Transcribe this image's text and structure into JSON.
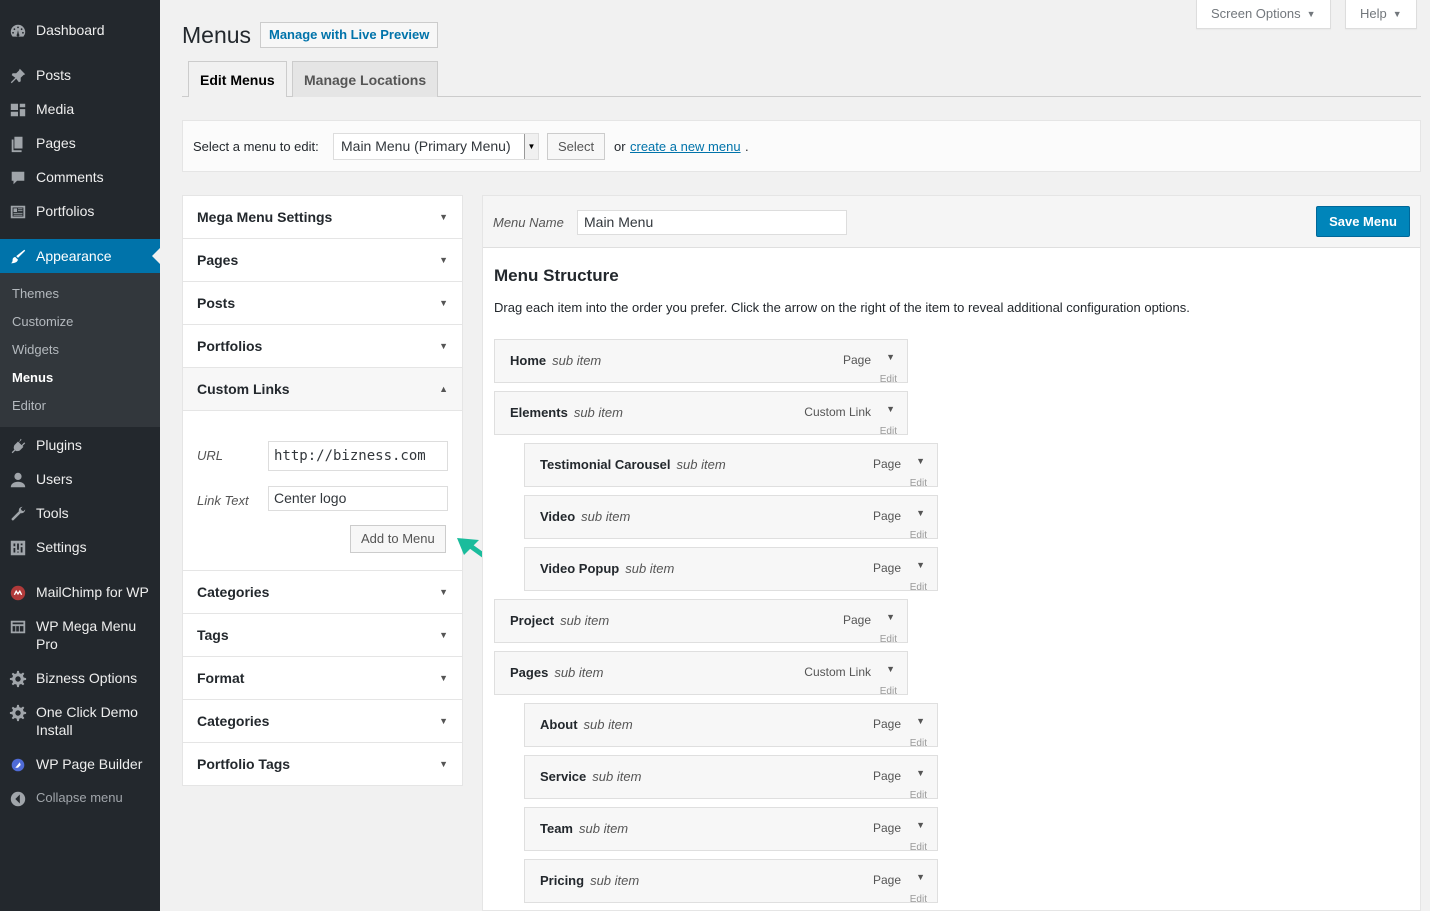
{
  "sidebar": {
    "items": [
      {
        "label": "Dashboard",
        "icon": "dashboard-icon"
      },
      {
        "label": "Posts",
        "icon": "pin-icon"
      },
      {
        "label": "Media",
        "icon": "media-icon"
      },
      {
        "label": "Pages",
        "icon": "pages-icon"
      },
      {
        "label": "Comments",
        "icon": "comments-icon"
      },
      {
        "label": "Portfolios",
        "icon": "portfolio-icon"
      },
      {
        "label": "Appearance",
        "icon": "paintbrush-icon"
      },
      {
        "label": "Plugins",
        "icon": "plugin-icon"
      },
      {
        "label": "Users",
        "icon": "users-icon"
      },
      {
        "label": "Tools",
        "icon": "wrench-icon"
      },
      {
        "label": "Settings",
        "icon": "settings-icon"
      },
      {
        "label": "MailChimp for WP",
        "icon": "mailchimp-icon"
      },
      {
        "label": "WP Mega Menu Pro",
        "icon": "mega-menu-icon"
      },
      {
        "label": "Bizness Options",
        "icon": "gear-icon"
      },
      {
        "label": "One Click Demo Install",
        "icon": "gear-icon"
      },
      {
        "label": "WP Page Builder",
        "icon": "page-builder-icon"
      }
    ],
    "submenu": [
      "Themes",
      "Customize",
      "Widgets",
      "Menus",
      "Editor"
    ],
    "collapse_label": "Collapse menu"
  },
  "header": {
    "title": "Menus",
    "live_preview_label": "Manage with Live Preview",
    "screen_options_label": "Screen Options",
    "help_label": "Help"
  },
  "tabs": [
    "Edit Menus",
    "Manage Locations"
  ],
  "select_bar": {
    "label": "Select a menu to edit:",
    "selected": "Main Menu (Primary Menu)",
    "select_button": "Select",
    "or_text": "or",
    "create_link": "create a new menu",
    "dot": "."
  },
  "accordion": {
    "sections": [
      "Mega Menu Settings",
      "Pages",
      "Posts",
      "Portfolios",
      "Custom Links",
      "Categories",
      "Tags",
      "Format",
      "Categories",
      "Portfolio Tags"
    ],
    "custom_links": {
      "url_label": "URL",
      "url_value": "http://bizness.com",
      "link_text_label": "Link Text",
      "link_text_value": "Center logo",
      "add_button": "Add to Menu"
    }
  },
  "menu_panel": {
    "name_label": "Menu Name",
    "name_value": "Main Menu",
    "save_button": "Save Menu",
    "structure_title": "Menu Structure",
    "structure_desc": "Drag each item into the order you prefer. Click the arrow on the right of the item to reveal additional configuration options.",
    "items": [
      {
        "title": "Home",
        "sub": "sub item",
        "type": "Page",
        "depth": 0
      },
      {
        "title": "Elements",
        "sub": "sub item",
        "type": "Custom Link",
        "depth": 0
      },
      {
        "title": "Testimonial Carousel",
        "sub": "sub item",
        "type": "Page",
        "depth": 1
      },
      {
        "title": "Video",
        "sub": "sub item",
        "type": "Page",
        "depth": 1
      },
      {
        "title": "Video Popup",
        "sub": "sub item",
        "type": "Page",
        "depth": 1
      },
      {
        "title": "Project",
        "sub": "sub item",
        "type": "Page",
        "depth": 0
      },
      {
        "title": "Pages",
        "sub": "sub item",
        "type": "Custom Link",
        "depth": 0
      },
      {
        "title": "About",
        "sub": "sub item",
        "type": "Page",
        "depth": 1
      },
      {
        "title": "Service",
        "sub": "sub item",
        "type": "Page",
        "depth": 1
      },
      {
        "title": "Team",
        "sub": "sub item",
        "type": "Page",
        "depth": 1
      },
      {
        "title": "Pricing",
        "sub": "sub item",
        "type": "Page",
        "depth": 1
      }
    ]
  },
  "colors": {
    "sidebar_bg": "#23282d",
    "accent": "#0073aa",
    "primary_button": "#0085ba",
    "pointer_arrow": "#1abc9c"
  }
}
